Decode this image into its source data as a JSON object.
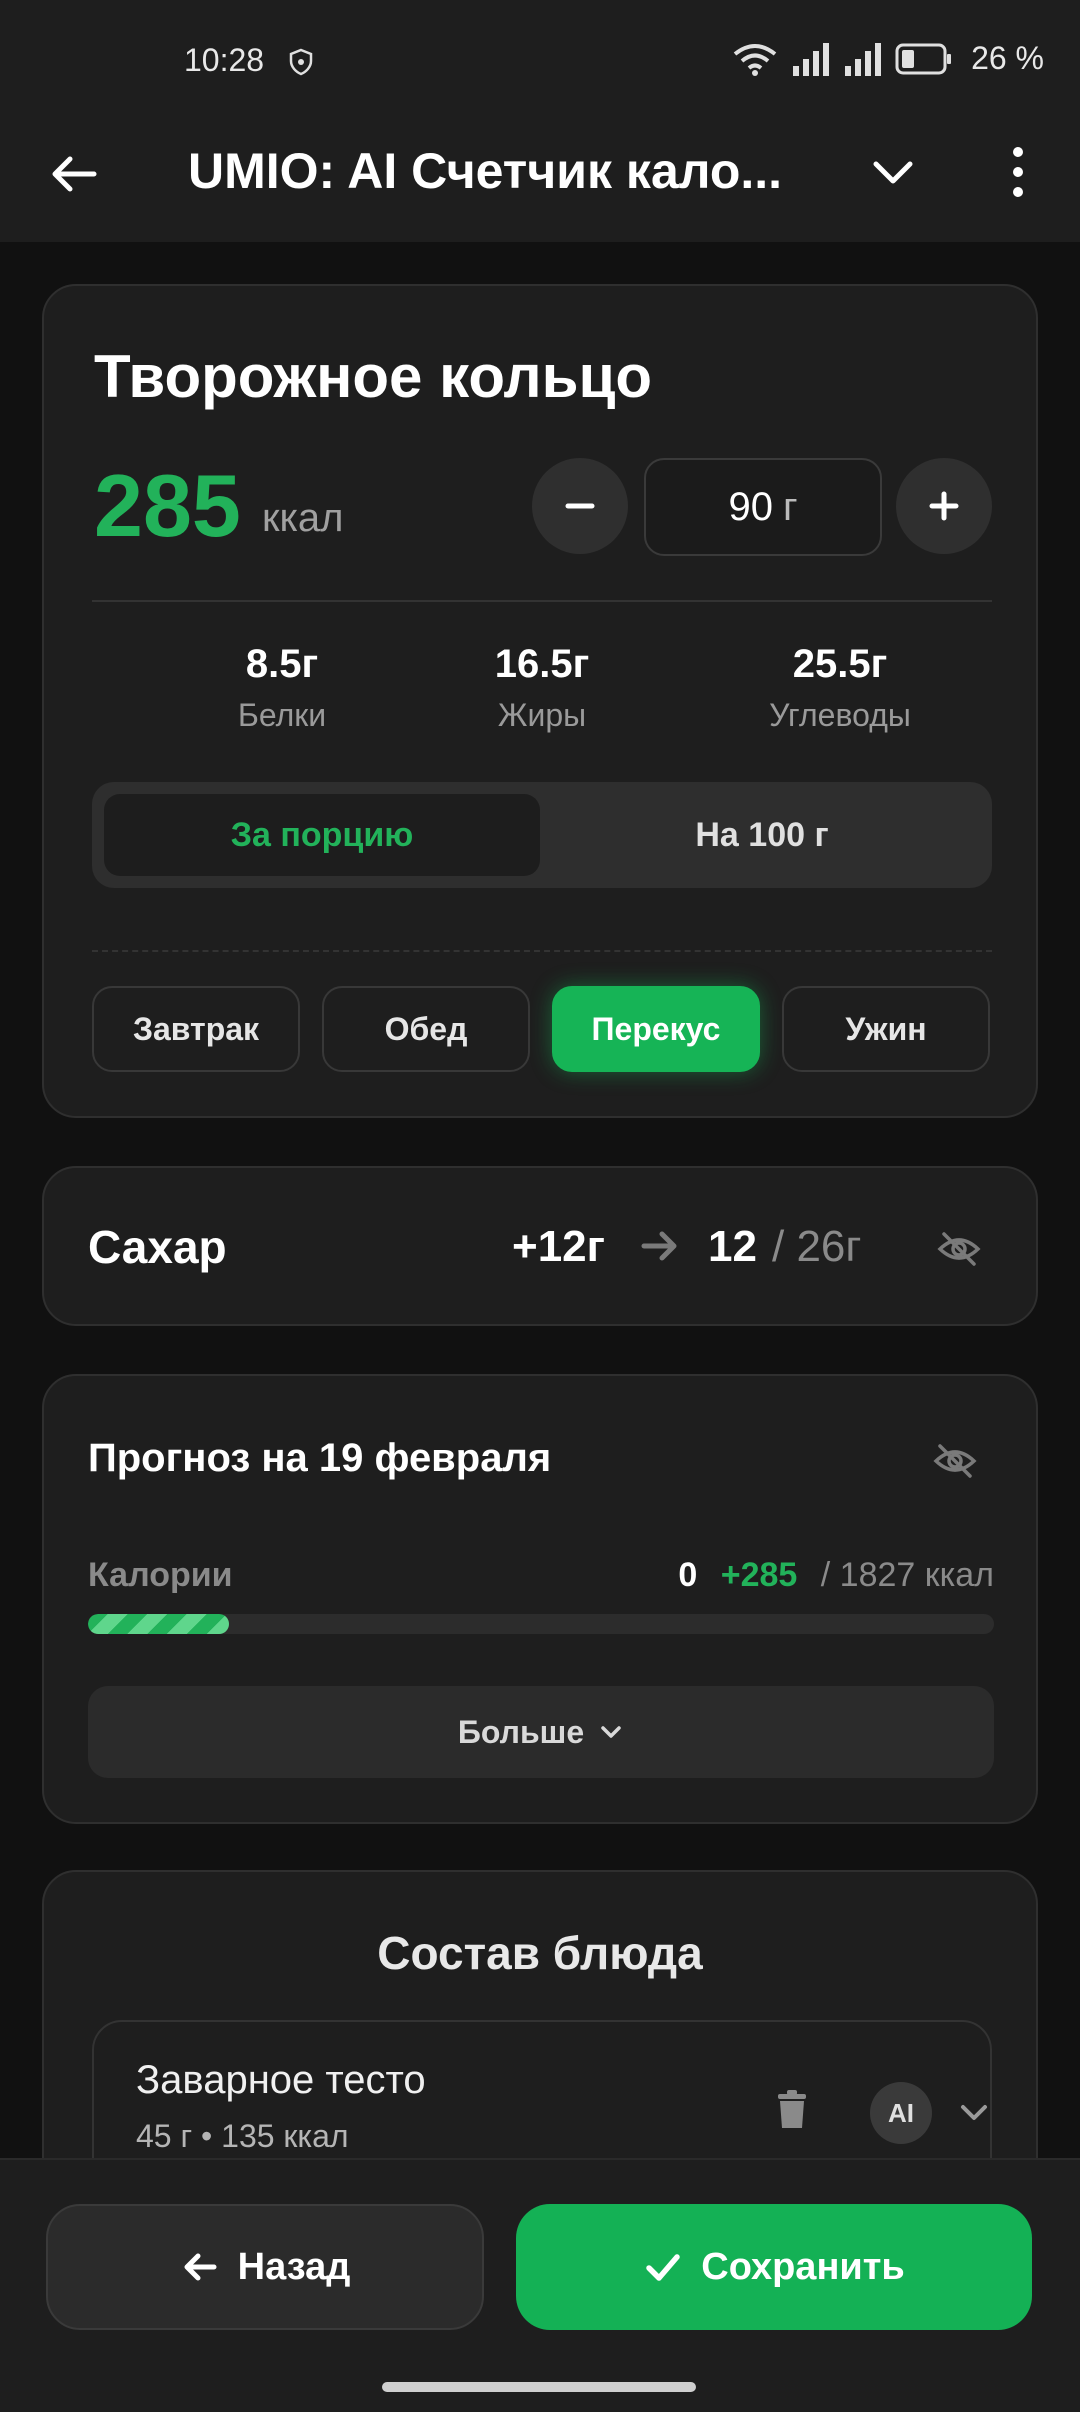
{
  "status_bar": {
    "time": "10:28",
    "battery_text": "26 %",
    "icons": [
      "shield-icon",
      "wifi-icon",
      "signal-icon",
      "signal-icon",
      "battery-icon"
    ]
  },
  "app_bar": {
    "title": "UMIO: AI Счетчик кало...",
    "icons": [
      "back-arrow-icon",
      "chevron-down-icon",
      "more-vert-icon"
    ]
  },
  "dish": {
    "title": "Творожное кольцо",
    "kcal": "285",
    "kcal_unit": "ккал",
    "weight_value": "90",
    "weight_unit": "г",
    "macros": [
      {
        "value": "8.5г",
        "label": "Белки"
      },
      {
        "value": "16.5г",
        "label": "Жиры"
      },
      {
        "value": "25.5г",
        "label": "Углеводы"
      }
    ],
    "toggle": {
      "per_portion": "За порцию",
      "per_100": "На 100 г",
      "selected": "per_portion"
    },
    "meals": [
      "Завтрак",
      "Обед",
      "Перекус",
      "Ужин"
    ],
    "selected_meal": "Перекус"
  },
  "sugar": {
    "label": "Сахар",
    "added": "+12г",
    "current": "12",
    "total": "/ 26г"
  },
  "forecast": {
    "title": "Прогноз на 19 февраля",
    "calories_label": "Калории",
    "current": "0",
    "added": "+285",
    "total": "/ 1827 ккал",
    "progress_fraction": 0.156,
    "more_label": "Больше"
  },
  "composition": {
    "title": "Состав блюда",
    "ingredients": [
      {
        "name": "Заварное тесто",
        "meta": "45 г • 135 ккал",
        "badge": "AI"
      }
    ]
  },
  "bottom": {
    "back_label": "Назад",
    "save_label": "Сохранить"
  },
  "colors": {
    "accent": "#14b155",
    "background": "#111111",
    "card": "#1e1e1e"
  }
}
